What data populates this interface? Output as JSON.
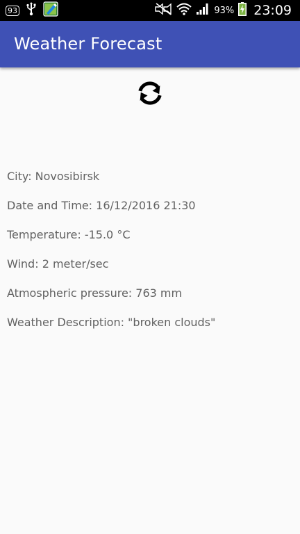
{
  "status_bar": {
    "notification_count": "93",
    "battery_percent": "93%",
    "time": "23:09",
    "icons": [
      "notification-count-icon",
      "usb-icon",
      "app-notification-icon",
      "mute-icon",
      "wifi-icon",
      "signal-icon",
      "battery-charging-icon"
    ]
  },
  "app_bar": {
    "title": "Weather Forecast",
    "color": "#3f51b5"
  },
  "refresh": {
    "icon": "refresh-icon"
  },
  "weather": {
    "city": "City: Novosibirsk",
    "datetime": "Date and Time: 16/12/2016 21:30",
    "temperature": "Temperature: -15.0 °C",
    "wind": "Wind: 2 meter/sec",
    "pressure": "Atmospheric pressure: 763 mm",
    "description": "Weather Description: \"broken clouds\""
  }
}
